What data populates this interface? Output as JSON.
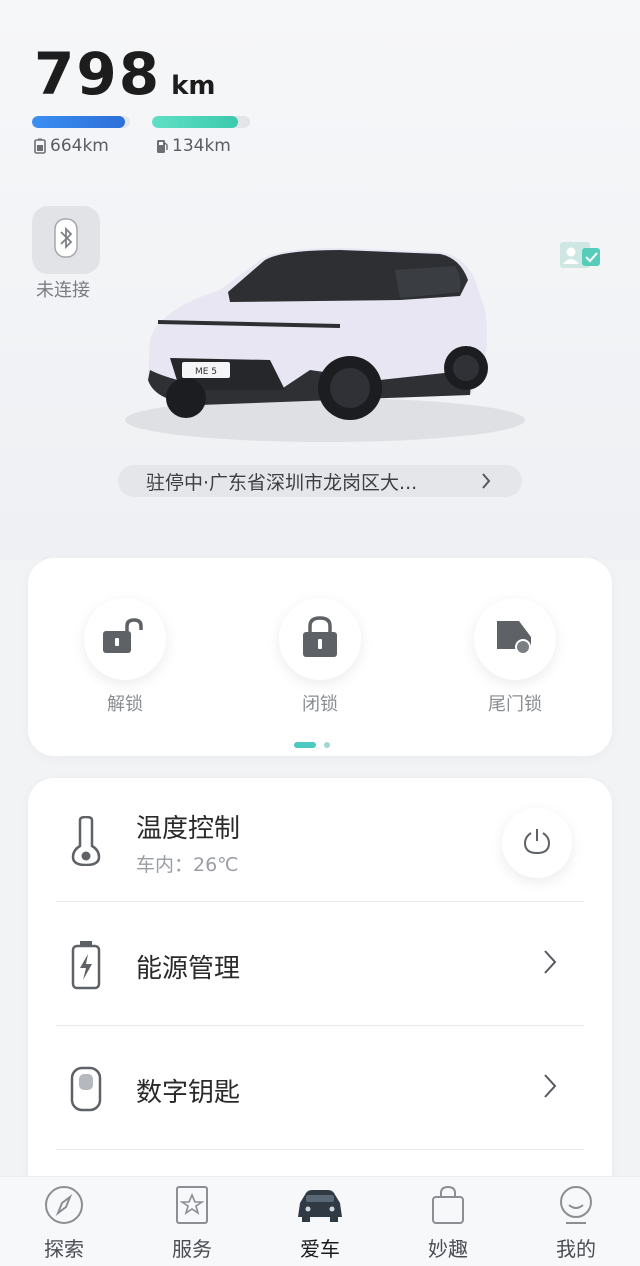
{
  "range": {
    "total_value": "798",
    "total_unit": "km",
    "ev_range": "664km",
    "fuel_range": "134km",
    "ev_fill_fraction": 0.95,
    "fuel_fill_fraction": 0.88,
    "ev_color": "#3a8ff2",
    "fuel_color": "#4fd6ba"
  },
  "bluetooth_key": {
    "icon": "bluetooth-icon",
    "status": "未连接"
  },
  "car": {
    "plate_text": "ME 5"
  },
  "location": {
    "text": "驻停中·广东省深圳市龙岗区大..."
  },
  "controls": {
    "items": [
      {
        "label": "解锁",
        "icon": "unlock-icon"
      },
      {
        "label": "闭锁",
        "icon": "lock-icon"
      },
      {
        "label": "尾门锁",
        "icon": "tailgate-icon"
      }
    ],
    "page_index": 1,
    "page_count": 2
  },
  "menu": {
    "temperature": {
      "title": "温度控制",
      "subtitle": "车内：26℃",
      "icon": "thermometer-icon"
    },
    "energy": {
      "title": "能源管理",
      "icon": "battery-charge-icon"
    },
    "digital_key": {
      "title": "数字钥匙",
      "icon": "key-fob-icon"
    }
  },
  "nav": {
    "items": [
      {
        "label": "探索",
        "icon": "compass-icon"
      },
      {
        "label": "服务",
        "icon": "star-bookmark-icon"
      },
      {
        "label": "爱车",
        "icon": "car-icon"
      },
      {
        "label": "妙趣",
        "icon": "shopping-bag-icon"
      },
      {
        "label": "我的",
        "icon": "profile-icon"
      }
    ],
    "active": "爱车",
    "accent": "#2f3a45"
  }
}
